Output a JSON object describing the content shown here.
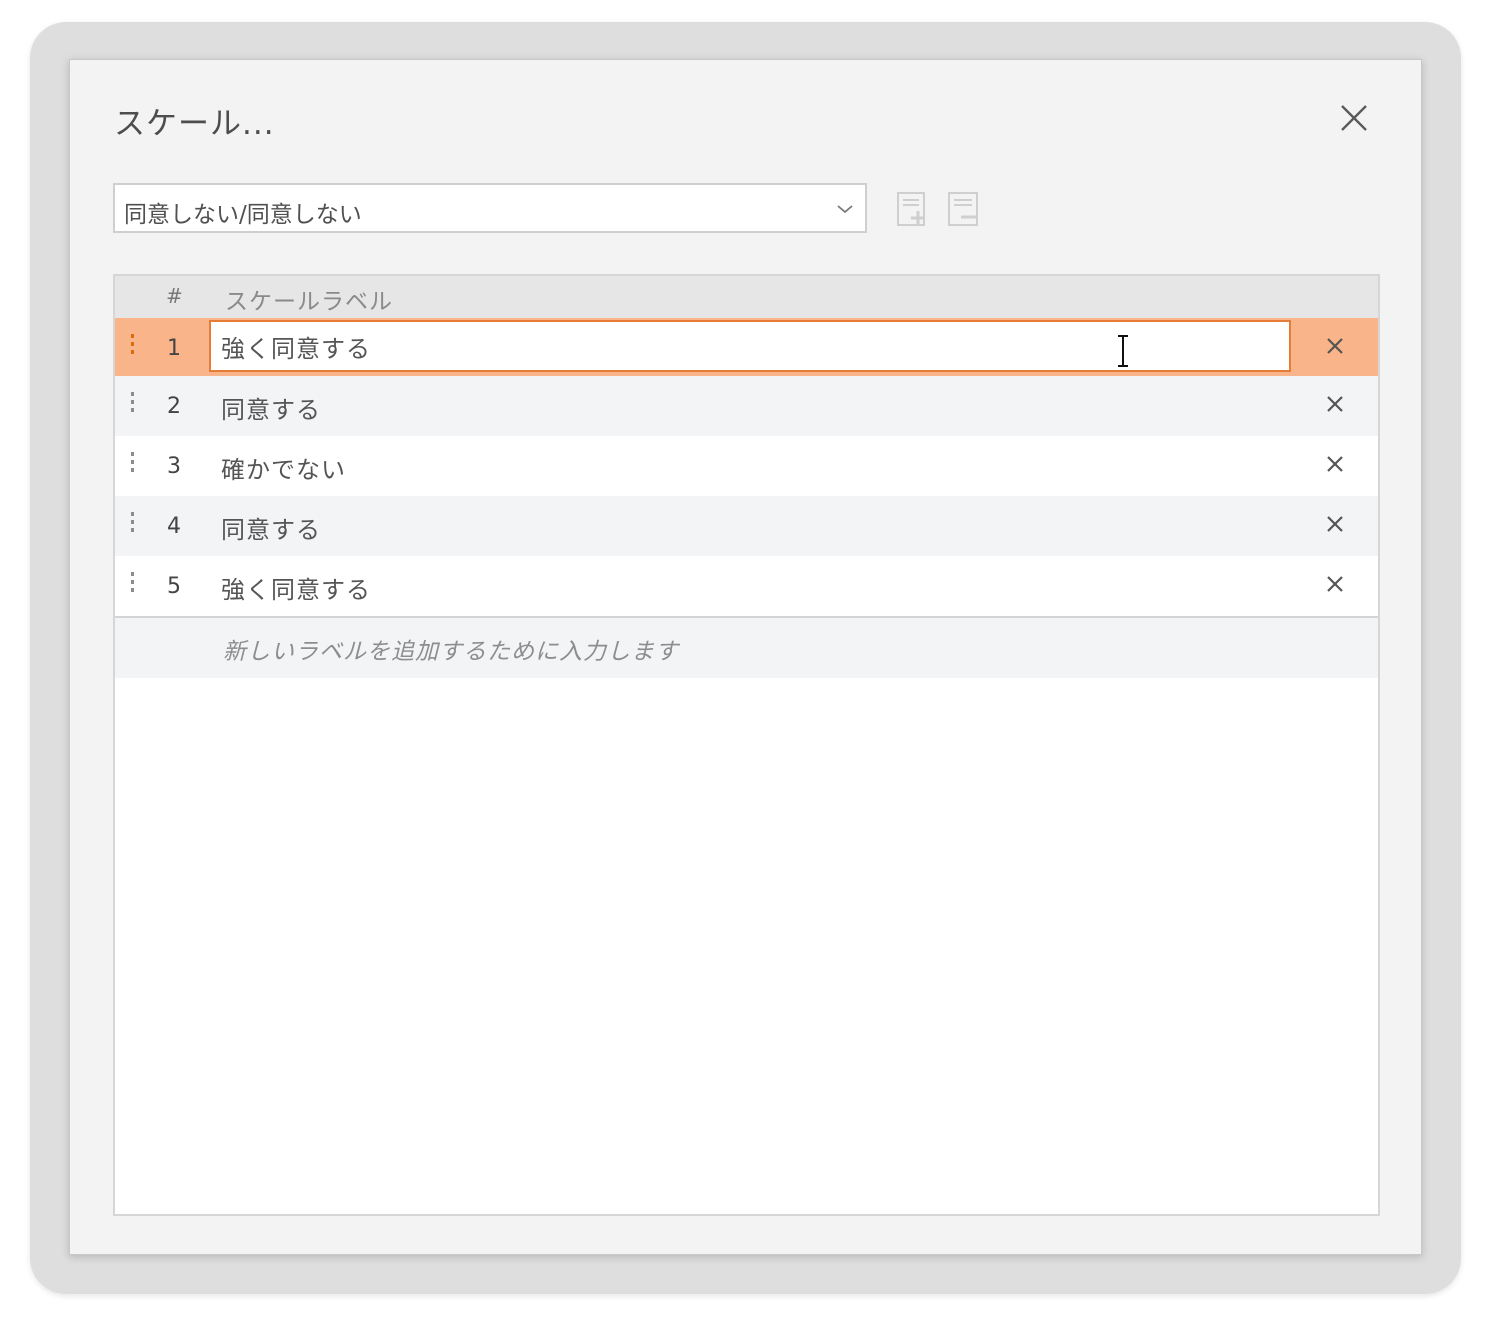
{
  "dialog": {
    "title": "スケール..."
  },
  "scale_selector": {
    "selected": "同意しない/同意しない"
  },
  "toolbar": {
    "add_icon": "add-scale-icon",
    "remove_icon": "remove-scale-icon"
  },
  "grid": {
    "header": {
      "number": "#",
      "label": "スケールラベル"
    },
    "rows": [
      {
        "number": "1",
        "label": "強く同意する",
        "selected": true
      },
      {
        "number": "2",
        "label": "同意する",
        "selected": false
      },
      {
        "number": "3",
        "label": "確かでない",
        "selected": false
      },
      {
        "number": "4",
        "label": "同意する",
        "selected": false
      },
      {
        "number": "5",
        "label": "強く同意する",
        "selected": false
      }
    ],
    "new_row_placeholder": "新しいラベルを追加するために入力します"
  },
  "colors": {
    "accent": "#e57c37",
    "selected_row": "#f9b48a"
  }
}
